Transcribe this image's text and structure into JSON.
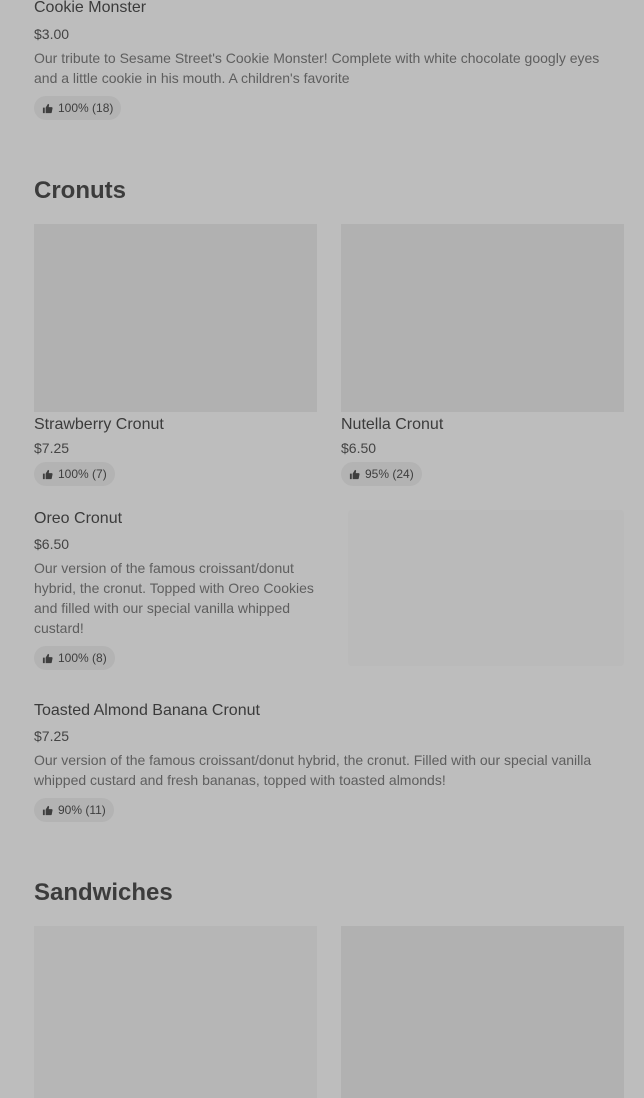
{
  "cookie_monster": {
    "name": "Cookie Monster",
    "price": "$3.00",
    "description": "Our tribute to Sesame Street's Cookie Monster! Complete with white chocolate googly eyes and a little cookie in his mouth. A children's favorite",
    "rating": "100% (18)"
  },
  "cronuts": {
    "title": "Cronuts",
    "items": [
      {
        "name": "Strawberry Cronut",
        "price": "$7.25",
        "rating": "100% (7)"
      },
      {
        "name": "Nutella Cronut",
        "price": "$6.50",
        "rating": "95% (24)"
      },
      {
        "name": "Oreo Cronut",
        "price": "$6.50",
        "description": "Our version of the famous croissant/donut hybrid, the cronut. Topped with Oreo Cookies and filled with our special vanilla whipped custard!",
        "rating": "100% (8)"
      },
      {
        "name": "Toasted Almond Banana Cronut",
        "price": "$7.25",
        "description": "Our version of the famous croissant/donut hybrid, the cronut. Filled with our special vanilla whipped custard and fresh bananas, topped with toasted almonds!",
        "rating": "90% (11)"
      }
    ]
  },
  "sandwiches": {
    "title": "Sandwiches"
  },
  "icons": {
    "rating": "thumbs-up-icon"
  }
}
